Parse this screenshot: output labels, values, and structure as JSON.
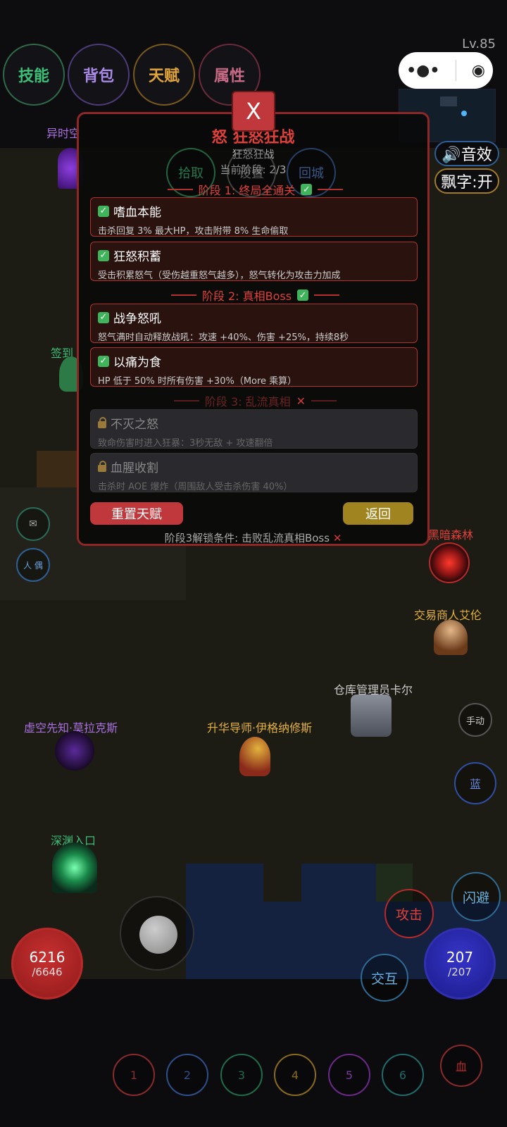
{
  "top_menu": {
    "skills": "技能",
    "bag": "背包",
    "talent": "天赋",
    "attributes": "属性"
  },
  "level": "Lv.85",
  "capsule": {
    "more": "•●•",
    "close": "◉"
  },
  "side_toggles": {
    "sound": "🔊音效",
    "float_text": "飘字:开"
  },
  "talent_panel": {
    "close": "X",
    "title": "怒 狂怒狂战",
    "subtitle": "狂怒狂战",
    "current_stage": "当前阶段: 2/3",
    "overlay_buttons": {
      "pickup": "拾取",
      "settings": "设置",
      "return_city": "回城"
    },
    "stages": [
      {
        "header": "阶段 1: 终局全通关",
        "status": "✅",
        "talents": [
          {
            "name": "嗜血本能",
            "desc": "击杀回复 3% 最大HP，攻击附带 8% 生命偷取"
          },
          {
            "name": "狂怒积蓄",
            "desc": "受击积累怒气（受伤越重怒气越多），怒气转化为攻击力加成"
          }
        ]
      },
      {
        "header": "阶段 2: 真相Boss",
        "status": "✅",
        "talents": [
          {
            "name": "战争怒吼",
            "desc": "怒气满时自动释放战吼：攻速 +40%、伤害 +25%，持续8秒"
          },
          {
            "name": "以痛为食",
            "desc": "HP 低于 50% 时所有伤害 +30%（More 乘算）"
          }
        ]
      },
      {
        "header": "阶段 3: 乱流真相",
        "status": "✕",
        "talents": [
          {
            "name": "不灭之怒",
            "desc": "致命伤害时进入狂暴：3秒无敌 + 攻速翻倍"
          },
          {
            "name": "血腥收割",
            "desc": "击杀时 AOE 爆炸（周围敌人受击杀伤害 40%）"
          }
        ]
      }
    ],
    "reset": "重置天赋",
    "back": "返回",
    "unlock_note": "阶段3解锁条件: 击败乱流真相Boss"
  },
  "npcs": {
    "portal_top": "异时空",
    "checkin": "签到",
    "dark_forest": "黑暗森林",
    "trader": "交易商人艾伦",
    "warehouse": "仓库管理员卡尔",
    "void_prophet": "虚空先知·莫拉克斯",
    "ascension": "升华导师·伊格纳修斯",
    "abyss": "深渊入口"
  },
  "left_buttons": {
    "mail": "✉",
    "pet": "人 偶"
  },
  "right_buttons": {
    "manual": "手动",
    "blue": "蓝",
    "dodge": "闪避",
    "attack": "攻击",
    "interact": "交互"
  },
  "hp": {
    "current": "6216",
    "max": "/6646"
  },
  "mp": {
    "current": "207",
    "max": "/207"
  },
  "skill_slots": [
    "1",
    "2",
    "3",
    "4",
    "5",
    "6",
    "血"
  ],
  "colors": {
    "accent_red": "#c0383b",
    "panel_border": "#8f2727",
    "check_green": "#3fb45a",
    "gold": "#e3b23c"
  }
}
